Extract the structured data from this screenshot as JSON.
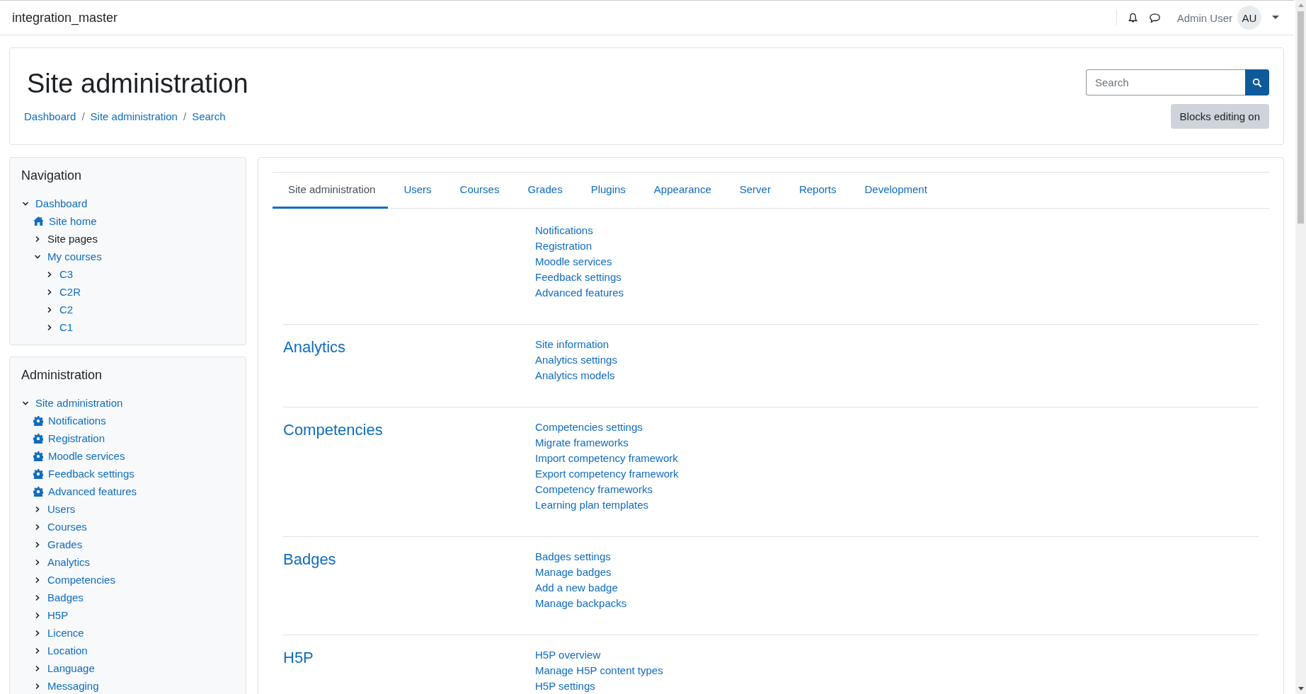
{
  "navbar": {
    "site_name": "integration_master",
    "user_name": "Admin User",
    "avatar_initials": "AU"
  },
  "header": {
    "title": "Site administration",
    "breadcrumbs": [
      "Dashboard",
      "Site administration",
      "Search"
    ],
    "breadcrumb_separator": "/",
    "search": {
      "placeholder": "Search"
    },
    "edit_button": "Blocks editing on"
  },
  "navigation_block": {
    "title": "Navigation",
    "items": [
      {
        "label": "Dashboard",
        "kind": "node",
        "link": true,
        "expanded": true,
        "children": [
          {
            "label": "Site home",
            "kind": "home",
            "link": true
          },
          {
            "label": "Site pages",
            "kind": "node",
            "link": false,
            "expanded": false
          },
          {
            "label": "My courses",
            "kind": "node",
            "link": true,
            "expanded": true,
            "children": [
              {
                "label": "C3",
                "kind": "node",
                "link": true,
                "expanded": false
              },
              {
                "label": "C2R",
                "kind": "node",
                "link": true,
                "expanded": false
              },
              {
                "label": "C2",
                "kind": "node",
                "link": true,
                "expanded": false
              },
              {
                "label": "C1",
                "kind": "node",
                "link": true,
                "expanded": false
              }
            ]
          }
        ]
      }
    ]
  },
  "administration_block": {
    "title": "Administration",
    "items": [
      {
        "label": "Site administration",
        "kind": "node",
        "link": true,
        "expanded": true,
        "children": [
          {
            "label": "Notifications",
            "kind": "setting",
            "link": true
          },
          {
            "label": "Registration",
            "kind": "setting",
            "link": true
          },
          {
            "label": "Moodle services",
            "kind": "setting",
            "link": true
          },
          {
            "label": "Feedback settings",
            "kind": "setting",
            "link": true
          },
          {
            "label": "Advanced features",
            "kind": "setting",
            "link": true
          },
          {
            "label": "Users",
            "kind": "node",
            "link": true,
            "expanded": false
          },
          {
            "label": "Courses",
            "kind": "node",
            "link": true,
            "expanded": false
          },
          {
            "label": "Grades",
            "kind": "node",
            "link": true,
            "expanded": false
          },
          {
            "label": "Analytics",
            "kind": "node",
            "link": true,
            "expanded": false
          },
          {
            "label": "Competencies",
            "kind": "node",
            "link": true,
            "expanded": false
          },
          {
            "label": "Badges",
            "kind": "node",
            "link": true,
            "expanded": false
          },
          {
            "label": "H5P",
            "kind": "node",
            "link": true,
            "expanded": false
          },
          {
            "label": "Licence",
            "kind": "node",
            "link": true,
            "expanded": false
          },
          {
            "label": "Location",
            "kind": "node",
            "link": true,
            "expanded": false
          },
          {
            "label": "Language",
            "kind": "node",
            "link": true,
            "expanded": false
          },
          {
            "label": "Messaging",
            "kind": "node",
            "link": true,
            "expanded": false
          }
        ]
      }
    ]
  },
  "tabs": [
    {
      "label": "Site administration",
      "selected": true
    },
    {
      "label": "Users",
      "selected": false
    },
    {
      "label": "Courses",
      "selected": false
    },
    {
      "label": "Grades",
      "selected": false
    },
    {
      "label": "Plugins",
      "selected": false
    },
    {
      "label": "Appearance",
      "selected": false
    },
    {
      "label": "Server",
      "selected": false
    },
    {
      "label": "Reports",
      "selected": false
    },
    {
      "label": "Development",
      "selected": false
    }
  ],
  "sections": [
    {
      "links": [
        "Notifications",
        "Registration",
        "Moodle services",
        "Feedback settings",
        "Advanced features"
      ]
    },
    {
      "heading": "Analytics",
      "links": [
        "Site information",
        "Analytics settings",
        "Analytics models"
      ]
    },
    {
      "heading": "Competencies",
      "links": [
        "Competencies settings",
        "Migrate frameworks",
        "Import competency framework",
        "Export competency framework",
        "Competency frameworks",
        "Learning plan templates"
      ]
    },
    {
      "heading": "Badges",
      "links": [
        "Badges settings",
        "Manage badges",
        "Add a new badge",
        "Manage backpacks"
      ]
    },
    {
      "heading": "H5P",
      "links": [
        "H5P overview",
        "Manage H5P content types",
        "H5P settings"
      ]
    }
  ]
}
